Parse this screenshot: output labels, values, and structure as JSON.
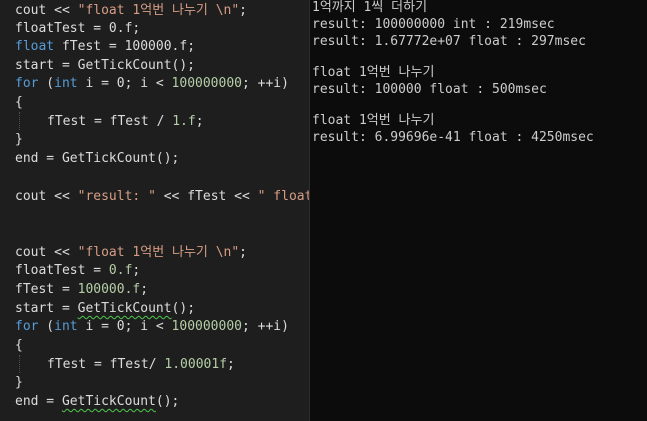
{
  "editor": {
    "block1": {
      "l1": {
        "a": "cout << ",
        "b": "\"float 1억번 나누기 \\n\"",
        "c": ";"
      },
      "l2": "floatTest = 0.f;",
      "l3": {
        "a": "float",
        "b": " fTest = 100000.f;"
      },
      "l4": "start = GetTickCount();",
      "l5": {
        "a": "for",
        "b": " (",
        "c": "int",
        "d": " i = 0; i < ",
        "e": "100000000",
        "f": "; ++i)"
      },
      "l6": "{",
      "l7": {
        "a": "fTest = fTest / ",
        "b": "1.f",
        "c": ";"
      },
      "l8": "}",
      "l9": "end = GetTickCount();",
      "l10": {
        "a": "cout << ",
        "b": "\"result: \"",
        "c": " << fTest << ",
        "d": "\" float"
      }
    },
    "block2": {
      "l1": {
        "a": "cout << ",
        "b": "\"float 1억번 나누기 \\n\"",
        "c": ";"
      },
      "l2": {
        "a": "floatTest = ",
        "b": "0.f",
        "c": ";"
      },
      "l3": {
        "a": "fTest = ",
        "b": "100000.f",
        "c": ";"
      },
      "l4": {
        "a": "start = ",
        "b": "GetTickCount",
        "c": "();"
      },
      "l5": {
        "a": "for",
        "b": " (",
        "c": "int",
        "d": " i = 0; i < ",
        "e": "100000000",
        "f": "; ++i)"
      },
      "l6": "{",
      "l7": {
        "a": "fTest = fTest/ ",
        "b": "1.00001f",
        "c": ";"
      },
      "l8": "}",
      "l9": {
        "a": "end = ",
        "b": "GetTickCount",
        "c": "();"
      }
    }
  },
  "console": {
    "lines": [
      "1억까지 1씩 더하기",
      "result: 100000000 int : 219msec",
      "result: 1.67772e+07 float : 297msec",
      "float 1억번 나누기",
      "result: 100000 float : 500msec",
      "float 1억번 나누기",
      "result: 6.99696e-41 float : 4250msec"
    ]
  },
  "colors": {
    "editor_bg": "#1e1e1e",
    "console_bg": "#0c0c0c",
    "keyword": "#569cd6",
    "string": "#d69d85",
    "number": "#b5cea8",
    "text": "#dcdcdc",
    "squiggle": "#4ec94e"
  }
}
